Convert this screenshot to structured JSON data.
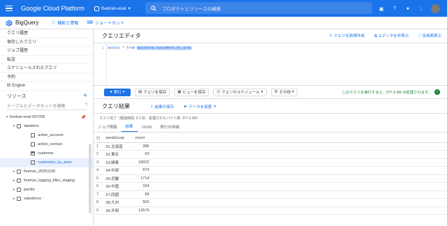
{
  "topbar": {
    "brand": "Google Cloud Platform",
    "project": "fivetran-eval",
    "search_placeholder": "プロダクトとリソースの検索"
  },
  "appbar": {
    "title": "BigQuery",
    "features_link": "機能と情報",
    "shortcut_link": "ショートカット"
  },
  "sidebar": {
    "nav": [
      "クエリ履歴",
      "保存したクエリ",
      "ジョブ履歴",
      "転送",
      "スケジュールされたクエリ",
      "予約",
      "BI Engine"
    ],
    "resources_label": "リソース",
    "resources_search": "テーブルとデータセットを検索",
    "tree": {
      "project": "fivetran-eval-297208",
      "dataset": "dataform",
      "tables": [
        "active_account",
        "active_contact",
        "customer",
        "customers_by_area"
      ],
      "other": [
        "fivetran_20201130",
        "fivetran_logging_filter_staging",
        "pardot",
        "salesforce"
      ]
    }
  },
  "editor": {
    "title": "クエリエディタ",
    "new_query": "クエリを新規作成",
    "hide_editor": "エディタを非表示",
    "fullscreen": "全画面表示",
    "line_number": "1",
    "code_select": "select",
    "code_star": "*",
    "code_from": "from",
    "code_table": "dataform.customers_by_area"
  },
  "toolbar": {
    "run": "実行",
    "save_query": "クエリを保存",
    "save_view": "ビューを保存",
    "schedule": "クエリのスケジュール",
    "more": "その他",
    "validation": "このクエリを実行すると、377.6 KB が処理されます。"
  },
  "results": {
    "title": "クエリ結果",
    "save_results": "結果の保存",
    "explore": "データを探索",
    "job_info": "クエリ完了（経過時間: 0.3 秒、処理されたバイト数: 377.6 KB）",
    "tabs": [
      "ジョブ情報",
      "結果",
      "JSON",
      "実行の詳細"
    ],
    "headers": [
      "行",
      "areaGroup",
      "count"
    ],
    "rows": [
      [
        "1",
        "01.北海道",
        "286"
      ],
      [
        "2",
        "02.東北",
        "93"
      ],
      [
        "3",
        "03.関東",
        "18022"
      ],
      [
        "4",
        "04.中部",
        "674"
      ],
      [
        "5",
        "05.近畿",
        "1714"
      ],
      [
        "6",
        "06.中国",
        "154"
      ],
      [
        "7",
        "07.四国",
        "68"
      ],
      [
        "8",
        "08.九州",
        "502"
      ],
      [
        "9",
        "99.不明",
        "13579"
      ]
    ]
  },
  "colors": {
    "primary": "#1a73e8",
    "valid": "#188038"
  }
}
